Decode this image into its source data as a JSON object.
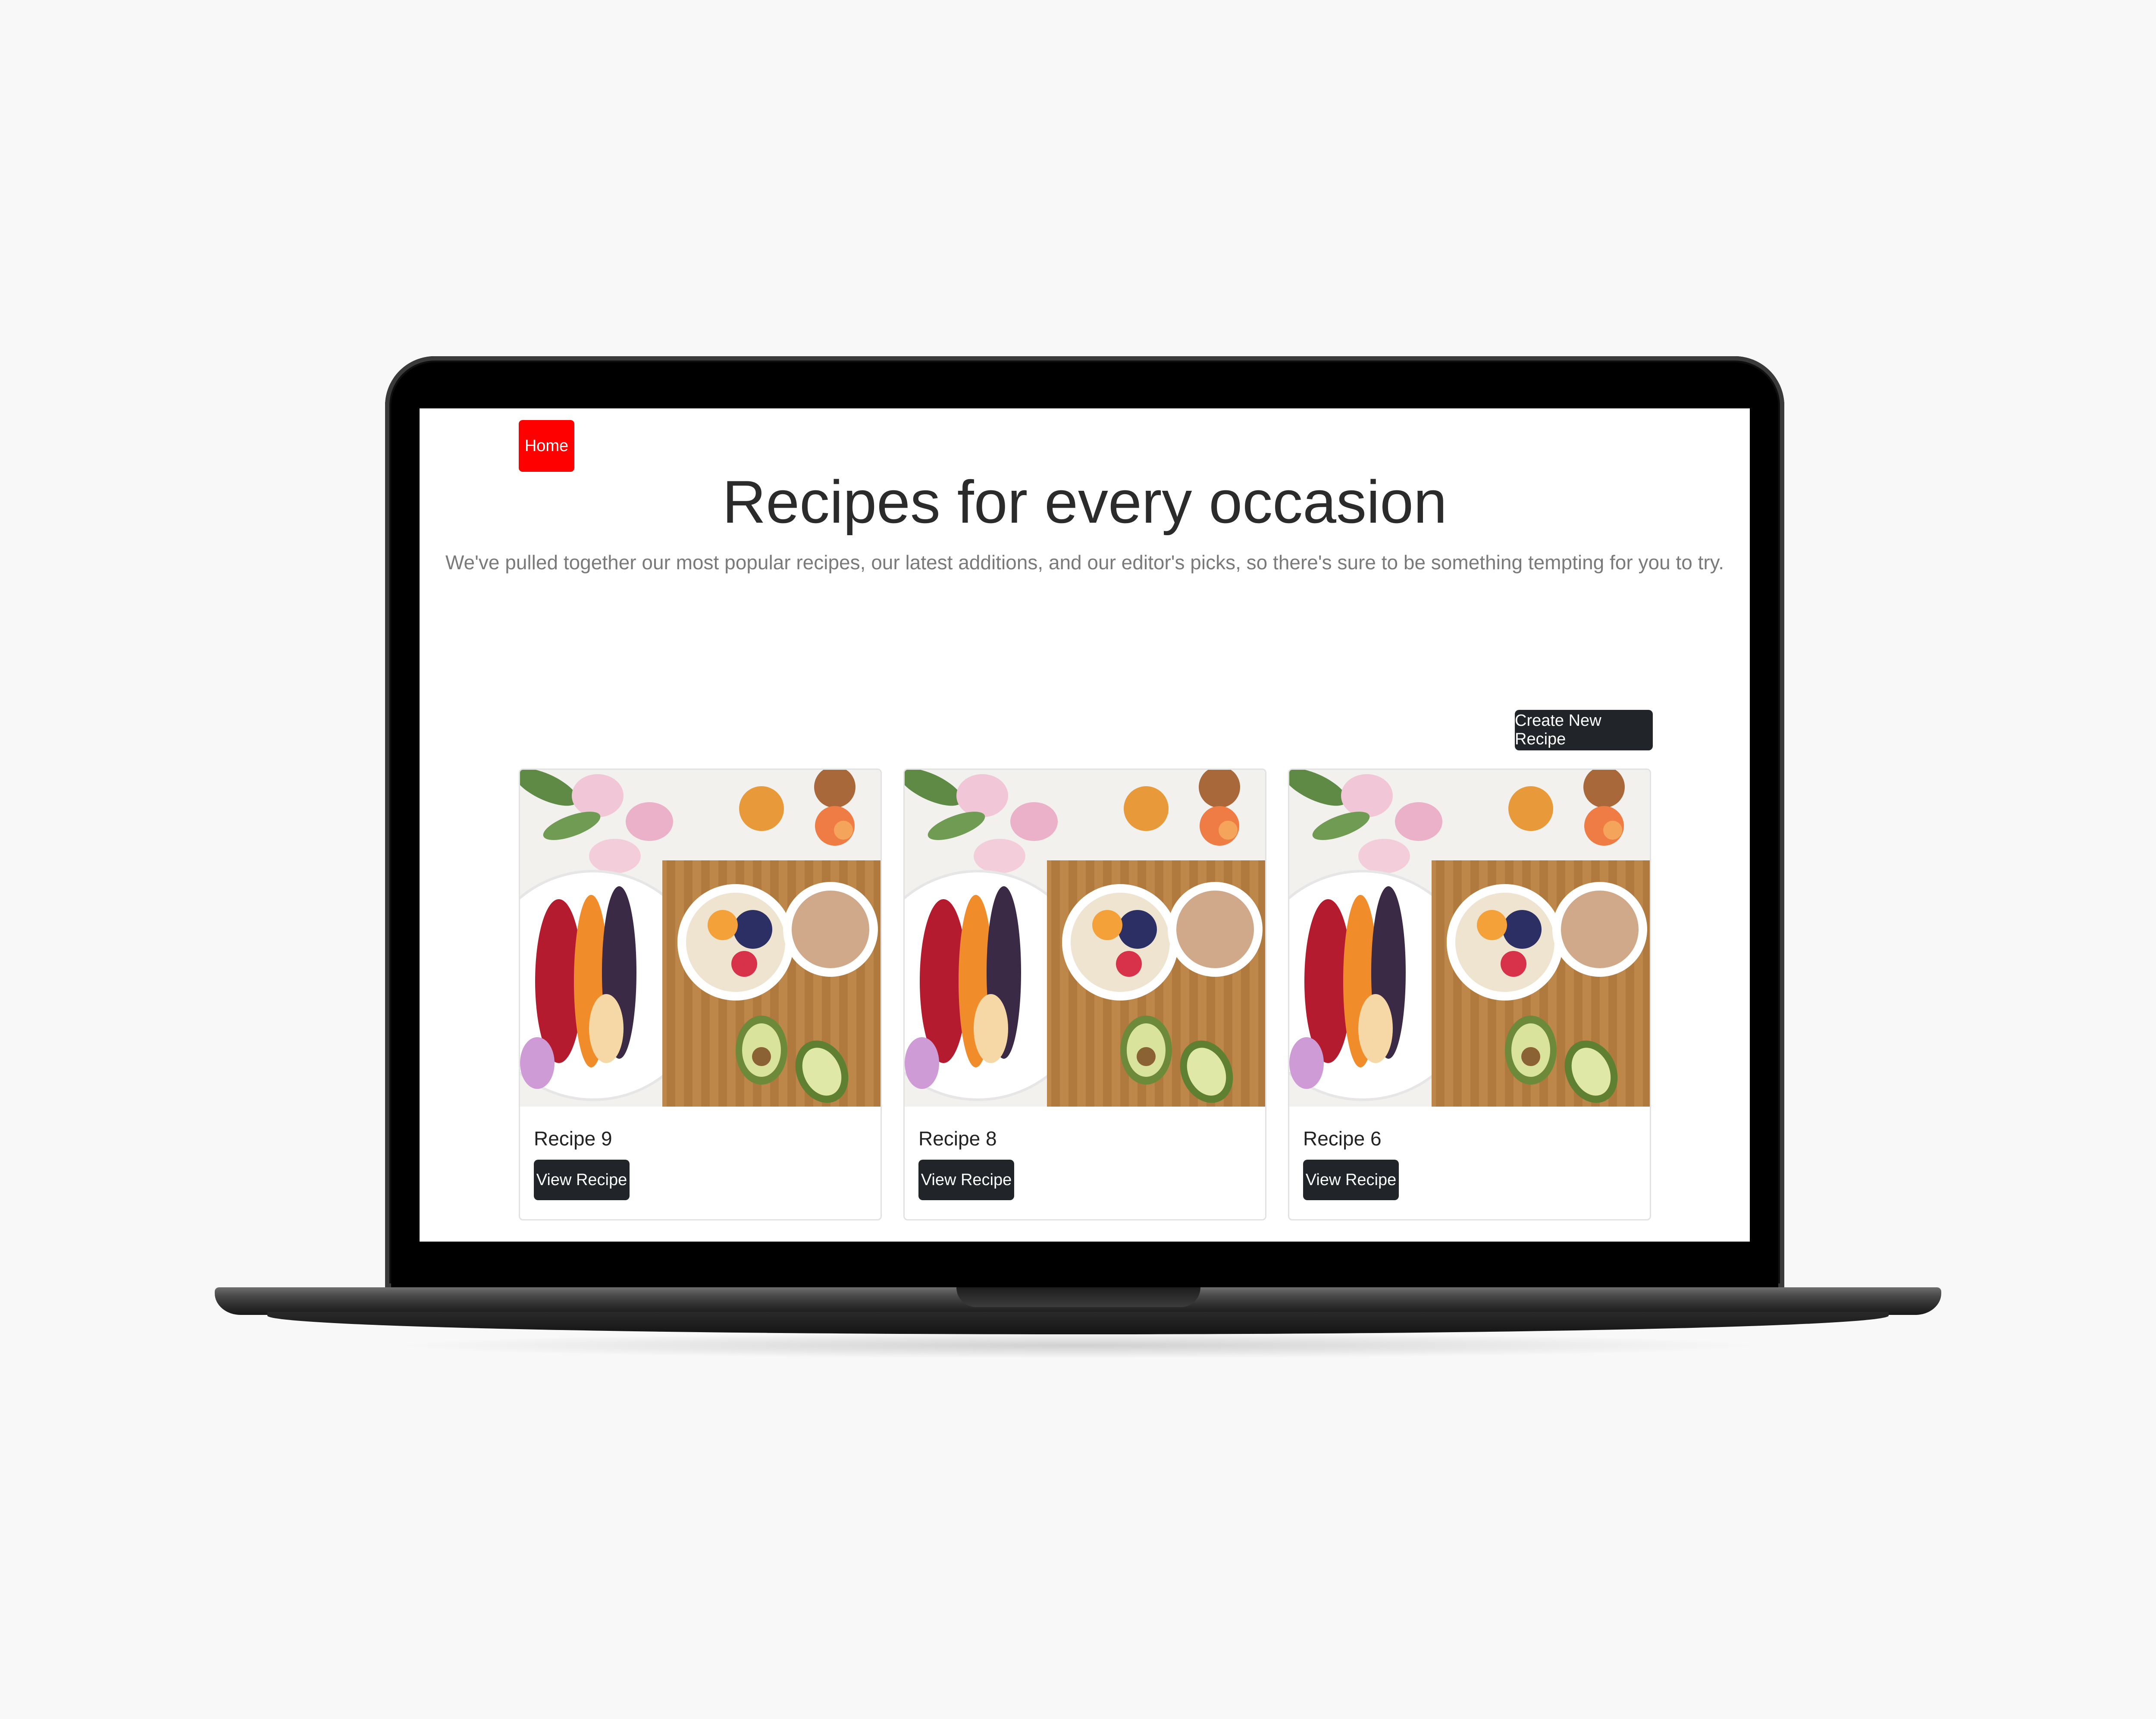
{
  "nav": {
    "home_label": "Home"
  },
  "hero": {
    "title": "Recipes for every occasion",
    "subtitle": "We've pulled together our most popular recipes, our latest additions, and our editor's picks, so there's sure to be something tempting for you to try."
  },
  "actions": {
    "create_label": "Create New Recipe"
  },
  "recipes": [
    {
      "title": "Recipe 9",
      "button": "View Recipe"
    },
    {
      "title": "Recipe 8",
      "button": "View Recipe"
    },
    {
      "title": "Recipe 6",
      "button": "View Recipe"
    }
  ],
  "colors": {
    "home_button": "#ff0000",
    "dark_button": "#212529"
  }
}
